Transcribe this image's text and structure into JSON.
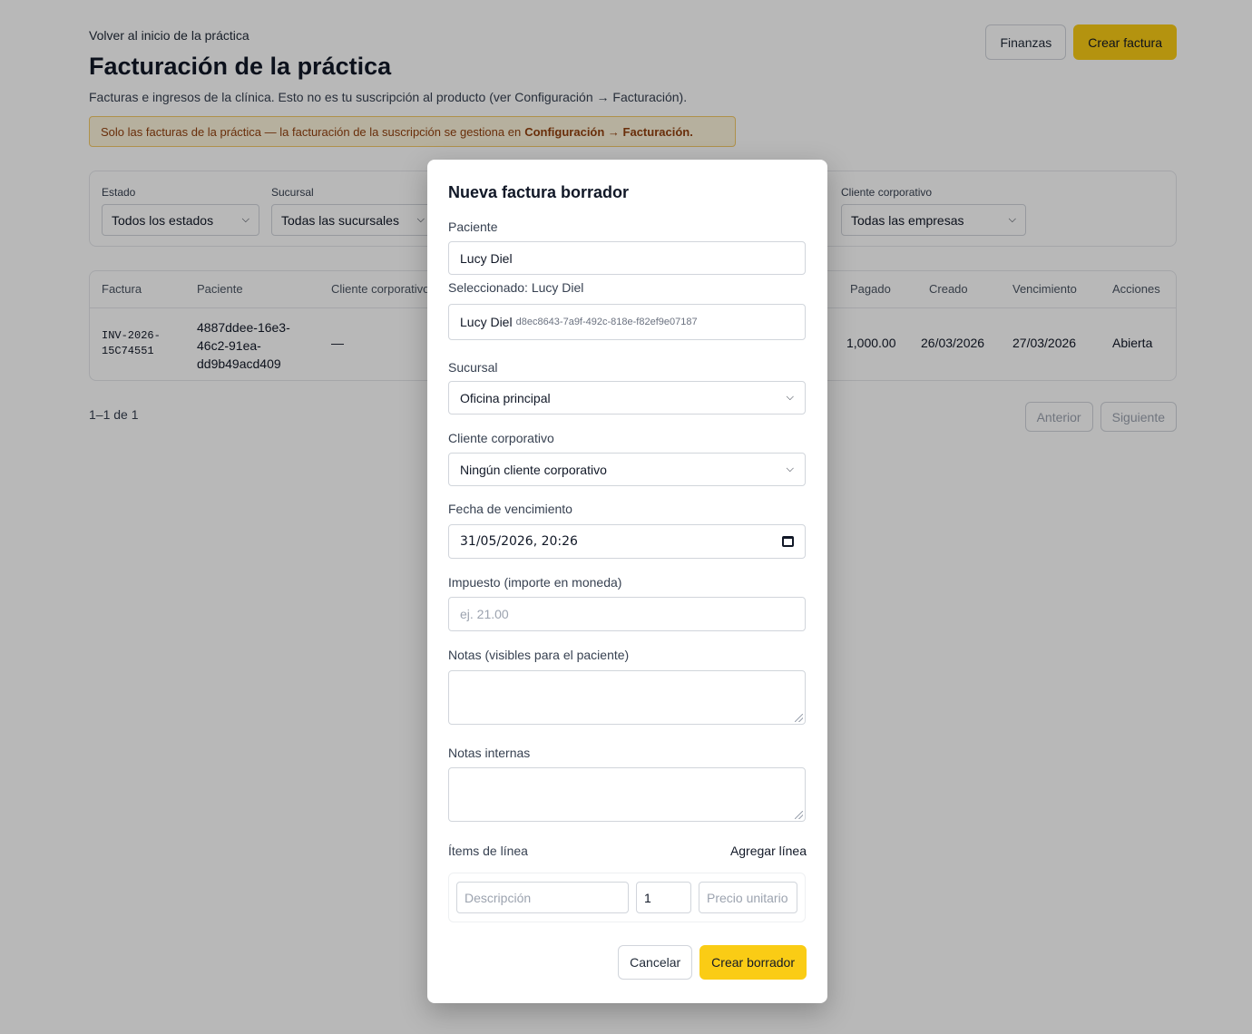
{
  "header": {
    "back_link": "Volver al inicio de la práctica",
    "title": "Facturación de la práctica",
    "subtitle": "Facturas e ingresos de la clínica. Esto no es tu suscripción al producto (ver Configuración → Facturación).",
    "finance_button": "Finanzas",
    "create_invoice_button": "Crear factura"
  },
  "notice": {
    "text": "Solo las facturas de la práctica — la facturación de la suscripción se gestiona en",
    "link": "Configuración → Facturación."
  },
  "filters": {
    "status": {
      "label": "Estado",
      "value": "Todos los estados"
    },
    "branch": {
      "label": "Sucursal",
      "value": "Todas las sucursales"
    },
    "corporate": {
      "label": "Cliente corporativo",
      "value": "Todas las empresas"
    }
  },
  "table": {
    "headers": {
      "invoice": "Factura",
      "patient": "Paciente",
      "corporate": "Cliente corporativo",
      "paid": "Pagado",
      "created": "Creado",
      "due": "Vencimiento",
      "actions": "Acciones"
    },
    "rows": [
      {
        "invoice_line1": "INV-2026-",
        "invoice_line2": "15C74551",
        "patient_line1": "4887ddee-16e3-",
        "patient_line2": "46c2-91ea-",
        "patient_line3": "dd9b49acd409",
        "corporate": "—",
        "paid": "1,000.00",
        "created": "26/03/2026",
        "due": "27/03/2026",
        "status": "Abierta"
      }
    ]
  },
  "pagination": {
    "count": "1–1 de 1",
    "prev": "Anterior",
    "next": "Siguiente"
  },
  "modal": {
    "title": "Nueva factura borrador",
    "patient_label": "Paciente",
    "patient_value": "Lucy Diel",
    "selected_text": "Seleccionado: Lucy Diel",
    "selected_option_name": "Lucy Diel",
    "selected_option_id": "d8ec8643-7a9f-492c-818e-f82ef9e07187",
    "branch_label": "Sucursal",
    "branch_value": "Oficina principal",
    "corporate_label": "Cliente corporativo",
    "corporate_value": "Ningún cliente corporativo",
    "due_label": "Fecha de vencimiento",
    "due_value": "31/05/2026, 20:26",
    "tax_label": "Impuesto (importe en moneda)",
    "tax_placeholder": "ej. 21.00",
    "notes_label": "Notas (visibles para el paciente)",
    "internal_notes_label": "Notas internas",
    "line_items_label": "Ítems de línea",
    "add_line": "Agregar línea",
    "line_description_placeholder": "Descripción",
    "line_qty_value": "1",
    "line_price_placeholder": "Precio unitario",
    "cancel": "Cancelar",
    "create_draft": "Crear borrador"
  },
  "colors": {
    "accent": "#facc15",
    "notice_bg": "#fdf4dc",
    "notice_text": "#92400e",
    "overlay": "rgba(0,0,0,0.28)"
  }
}
